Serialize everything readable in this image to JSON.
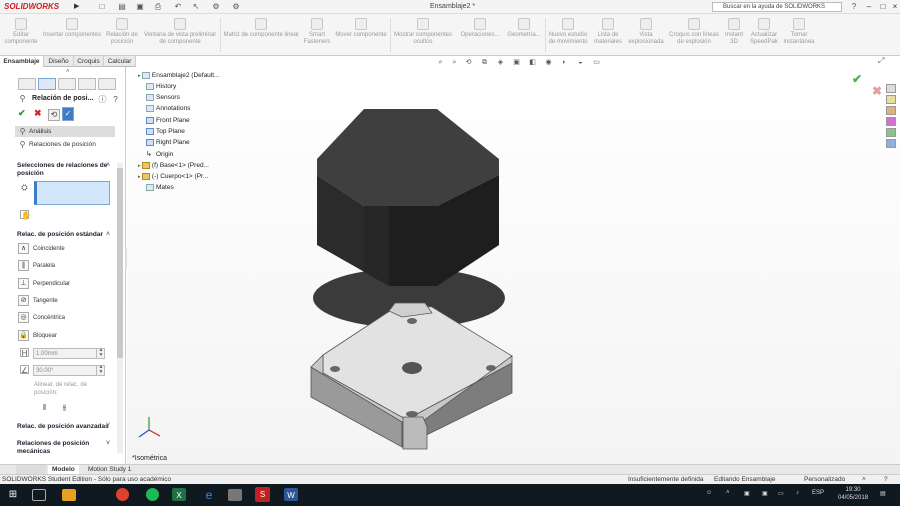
{
  "app": {
    "brand": "SOLIDWORKS",
    "doc_title": "Ensamblaje2 *",
    "help_search_placeholder": "Buscar en la ayuda de SOLIDWORKS"
  },
  "ribbon": {
    "items": [
      {
        "label": "Editar componente"
      },
      {
        "label": "Insertar componentes"
      },
      {
        "label": "Relación de posición"
      },
      {
        "label": "Ventana de vista preliminar de componente"
      },
      {
        "label": "Matriz de componente lineal"
      },
      {
        "label": "Smart Fasteners"
      },
      {
        "label": "Mover componente"
      },
      {
        "label": "Mostrar componentes ocultos"
      },
      {
        "label": "Operaciones..."
      },
      {
        "label": "Geometría..."
      },
      {
        "label": "Nuevo estudio de movimiento"
      },
      {
        "label": "Lista de materiales"
      },
      {
        "label": "Vista explosionada"
      },
      {
        "label": "Croquis con líneas de explosión"
      },
      {
        "label": "Instant 3D"
      },
      {
        "label": "Actualizar SpeedPak"
      },
      {
        "label": "Tomar instantánea"
      }
    ]
  },
  "command_tabs": [
    "Ensamblaje",
    "Diseño",
    "Croquis",
    "Calcular"
  ],
  "property_manager": {
    "title": "Relación de posi...",
    "tabs": [
      "Análisis",
      "Relaciones de posición"
    ],
    "sections": {
      "selections": "Selecciones de relaciones de posición",
      "standard": "Relac. de posición estándar",
      "advanced": "Relac. de posición avanzadas",
      "mechanical": "Relaciones de posición mecánicas"
    },
    "mates": [
      {
        "label": "Coincidente"
      },
      {
        "label": "Paralela"
      },
      {
        "label": "Perpendicular"
      },
      {
        "label": "Tangente"
      },
      {
        "label": "Concéntrica"
      },
      {
        "label": "Bloquear"
      }
    ],
    "distance_value": "1.00mm",
    "angle_value": "30.00°",
    "alignment_label": "Alinear, de relac. de posición:"
  },
  "feature_tree": {
    "root": "Ensamblaje2 (Default...",
    "items": [
      {
        "label": "History",
        "type": "folder"
      },
      {
        "label": "Sensors",
        "type": "folder"
      },
      {
        "label": "Annotations",
        "type": "folder"
      },
      {
        "label": "Front Plane",
        "type": "plane"
      },
      {
        "label": "Top Plane",
        "type": "plane"
      },
      {
        "label": "Right Plane",
        "type": "plane"
      },
      {
        "label": "Origin",
        "type": "origin"
      },
      {
        "label": "(f) Base<1> (Pred...",
        "type": "part"
      },
      {
        "label": "(-) Cuerpo<1> (Pr...",
        "type": "part"
      },
      {
        "label": "Mates",
        "type": "mates"
      }
    ]
  },
  "viewport": {
    "view_orientation": "*Isométrica"
  },
  "bottom_tabs": {
    "model": "Modelo",
    "motion": "Motion Study 1"
  },
  "status": {
    "edition": "SOLIDWORKS Student Edition - Sólo para uso académico",
    "definition": "Insuficientemente definida",
    "mode": "Editando Ensamblaje",
    "units": "Personalizado"
  },
  "taskbar": {
    "lang": "ESP",
    "time": "19:30",
    "date": "04/05/2018"
  },
  "colors": {
    "brand": "#d21c22",
    "accent": "#3d7cc7",
    "ok": "#2a9a2a",
    "cancel": "#cc2a2a"
  }
}
